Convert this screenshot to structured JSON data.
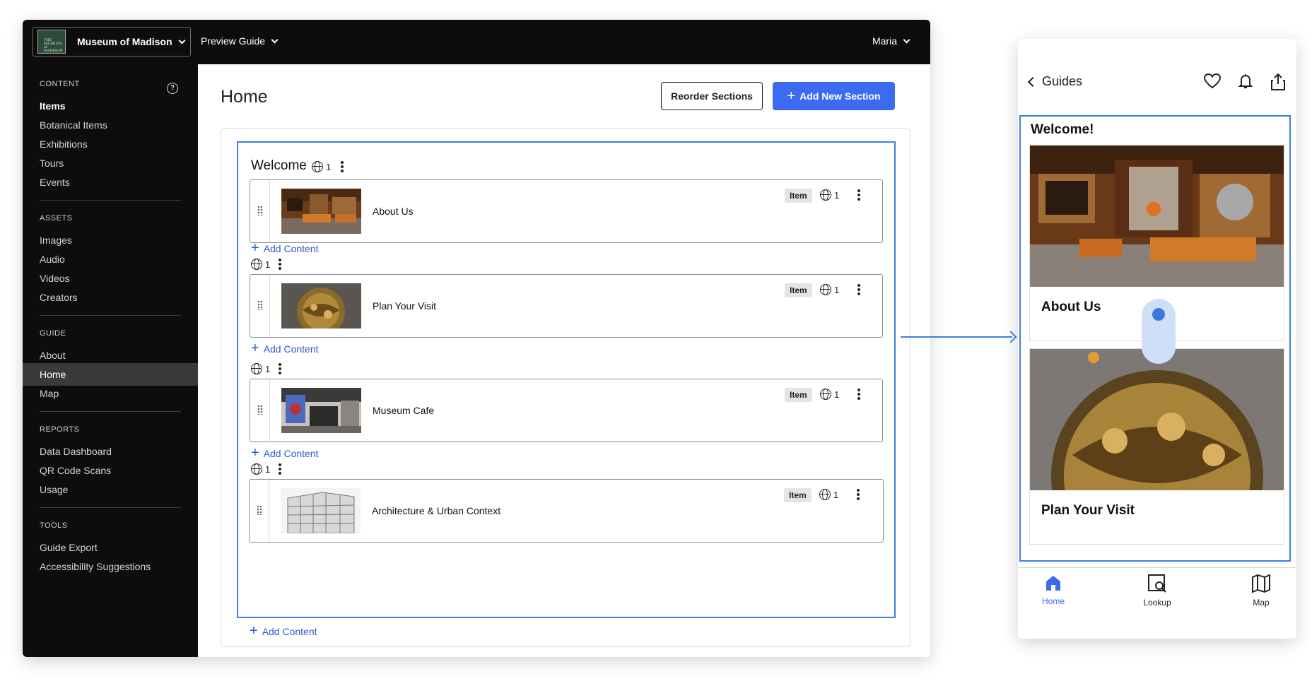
{
  "topbar": {
    "org_name": "Museum of Madison",
    "org_logo_text": "THE MUSEUM of MADISON",
    "preview_guide": "Preview Guide",
    "user": "Maria"
  },
  "sidebar": {
    "groups": [
      {
        "title": "CONTENT",
        "items": [
          "Items",
          "Botanical Items",
          "Exhibitions",
          "Tours",
          "Events"
        ]
      },
      {
        "title": "ASSETS",
        "items": [
          "Images",
          "Audio",
          "Videos",
          "Creators"
        ]
      },
      {
        "title": "GUIDE",
        "items": [
          "About",
          "Home",
          "Map"
        ]
      },
      {
        "title": "REPORTS",
        "items": [
          "Data Dashboard",
          "QR Code Scans",
          "Usage"
        ]
      },
      {
        "title": "TOOLS",
        "items": [
          "Guide Export",
          "Accessibility Suggestions"
        ]
      }
    ],
    "active_item": "Home"
  },
  "main": {
    "page_title": "Home",
    "reorder_label": "Reorder Sections",
    "add_section_label": "Add New Section",
    "section": {
      "title": "Welcome",
      "language_count": "1",
      "add_content_label": "Add Content",
      "cards": [
        {
          "title": "About Us",
          "badge": "Item",
          "language_count": "1",
          "language_count_row": "1"
        },
        {
          "title": "Plan Your Visit",
          "badge": "Item",
          "language_count": "1",
          "language_count_row": "1"
        },
        {
          "title": "Museum Cafe",
          "badge": "Item",
          "language_count": "1",
          "language_count_row": "1"
        },
        {
          "title": "Architecture & Urban Context",
          "badge": "Item",
          "language_count": "1",
          "language_count_row": "1"
        }
      ]
    }
  },
  "phone": {
    "back_label": "Guides",
    "section_title": "Welcome!",
    "cards": [
      {
        "title": "About Us"
      },
      {
        "title": "Plan Your Visit"
      }
    ],
    "tabs": [
      {
        "label": "Home",
        "icon": "home-icon",
        "active": true
      },
      {
        "label": "Lookup",
        "icon": "lookup-icon",
        "active": false
      },
      {
        "label": "Map",
        "icon": "map-icon",
        "active": false
      }
    ]
  },
  "colors": {
    "accent": "#3c6bf2",
    "selection": "#3f7ee8",
    "sidebar_bg": "#0d0d0d"
  }
}
